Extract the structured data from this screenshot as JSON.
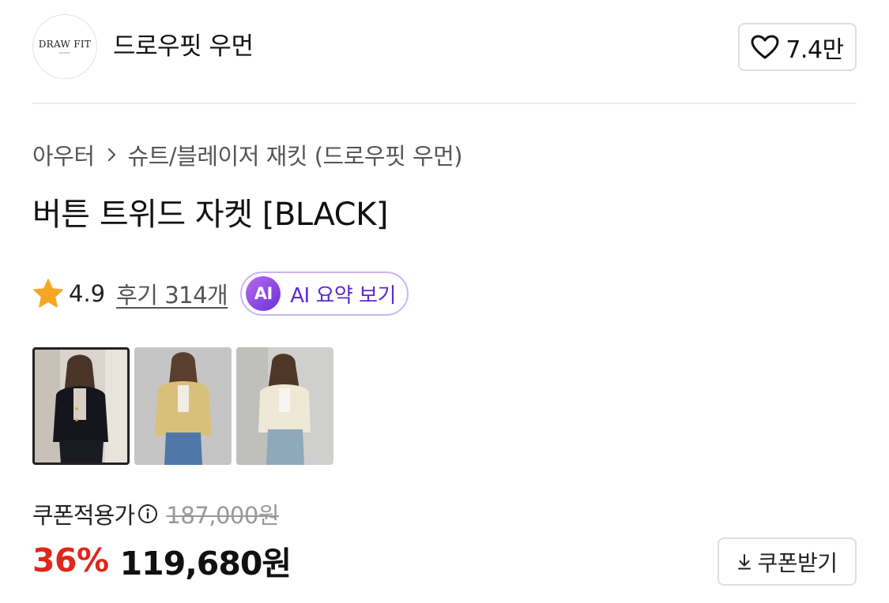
{
  "brand": {
    "logo_text": "DRAW FIT",
    "logo_subtext": "WOMEN",
    "name": "드로우핏 우먼",
    "like_count": "7.4만"
  },
  "breadcrumb": {
    "items": [
      "아우터",
      "슈트/블레이저 재킷 (드로우핏 우먼)"
    ]
  },
  "product": {
    "title": "버튼 트위드 자켓 [BLACK]",
    "rating": "4.9",
    "review_link": "후기 314개",
    "ai_badge": "AI",
    "ai_summary_label": "AI 요약 보기"
  },
  "thumbnails": [
    {
      "color": "black",
      "selected": true
    },
    {
      "color": "yellow",
      "selected": false
    },
    {
      "color": "ivory",
      "selected": false
    }
  ],
  "price": {
    "coupon_label": "쿠폰적용가",
    "original": "187,000원",
    "discount": "36%",
    "sale": "119,680원",
    "coupon_button": "쿠폰받기"
  },
  "colors": {
    "discount_red": "#e0261d",
    "ai_purple": "#5b2bd0",
    "star_orange": "#f5a623"
  },
  "icons": [
    "heart-icon",
    "chevron-right-icon",
    "star-icon",
    "info-icon",
    "download-icon"
  ]
}
